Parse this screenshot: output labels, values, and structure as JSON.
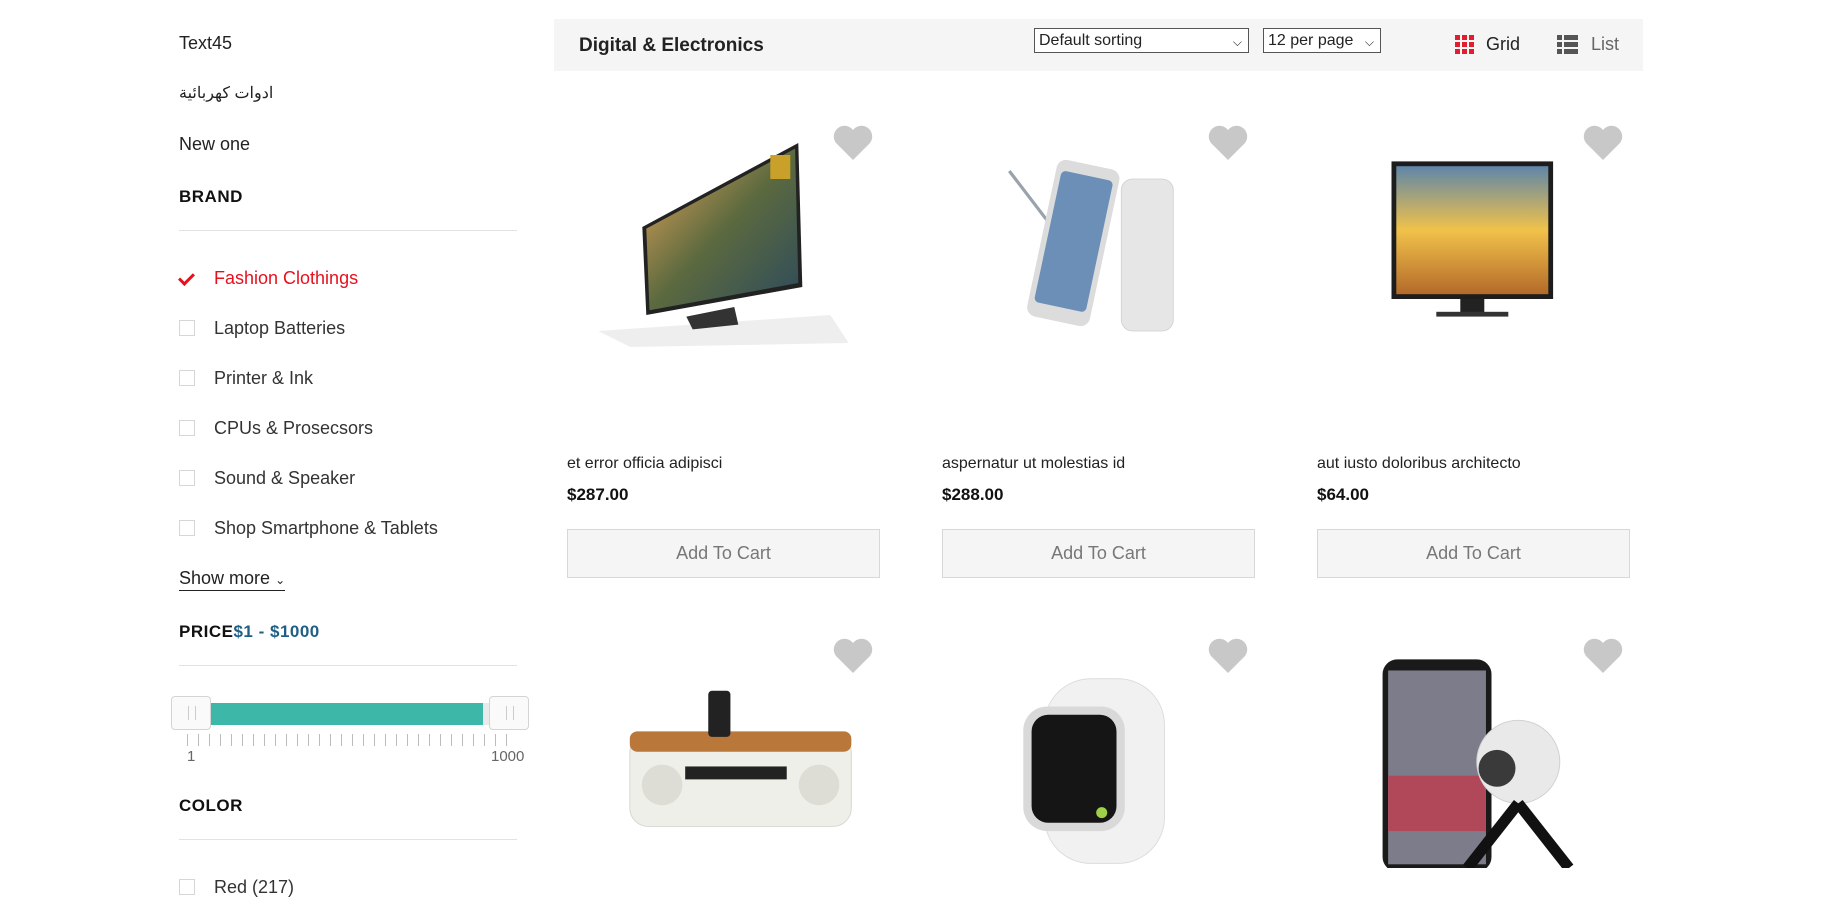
{
  "sidebar": {
    "categories": [
      "Text45",
      "ادوات كهربائية",
      "New one"
    ],
    "brand": {
      "title": "BRAND",
      "items": [
        {
          "label": "Fashion Clothings",
          "checked": true
        },
        {
          "label": "Laptop Batteries",
          "checked": false
        },
        {
          "label": "Printer & Ink",
          "checked": false
        },
        {
          "label": "CPUs & Prosecsors",
          "checked": false
        },
        {
          "label": "Sound & Speaker",
          "checked": false
        },
        {
          "label": "Shop Smartphone & Tablets",
          "checked": false
        }
      ],
      "show_more": "Show more"
    },
    "price": {
      "title": "PRICE",
      "range_label": "$1 - $1000",
      "min_label": "1",
      "max_label": "1000"
    },
    "color": {
      "title": "COLOR",
      "first_item": "Red (217)"
    }
  },
  "toolbar": {
    "title": "Digital & Electronics",
    "sorting": "Default sorting",
    "per_page": "12 per page",
    "grid_label": "Grid",
    "list_label": "List"
  },
  "products": [
    {
      "name": "et error officia adipisci",
      "price": "$287.00",
      "button": "Add To Cart",
      "image": "4k-tv-icon"
    },
    {
      "name": "aspernatur ut molestias id",
      "price": "$288.00",
      "button": "Add To Cart",
      "image": "smartphone-stylus-icon"
    },
    {
      "name": "aut iusto doloribus architecto",
      "price": "$64.00",
      "button": "Add To Cart",
      "image": "tv-beach-icon"
    },
    {
      "image": "speaker-dock-icon"
    },
    {
      "image": "smartwatch-icon"
    },
    {
      "image": "360-camera-phone-icon"
    }
  ],
  "colors": {
    "accent_red": "#e8101e",
    "slider_teal": "#3cb7a8",
    "price_blue": "#1f5f86"
  }
}
